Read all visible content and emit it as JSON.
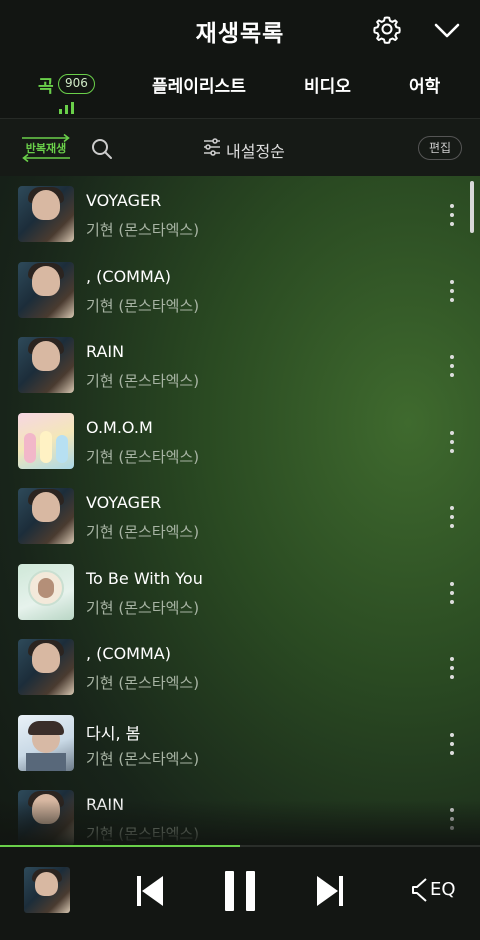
{
  "header": {
    "title": "재생목록"
  },
  "tabs": [
    {
      "label": "곡",
      "count": "906",
      "active": true
    },
    {
      "label": "플레이리스트"
    },
    {
      "label": "비디오"
    },
    {
      "label": "어학"
    }
  ],
  "toolbar": {
    "repeat_label": "반복재생",
    "sort_label": "내설정순",
    "edit_label": "편집"
  },
  "tracks": [
    {
      "title": "VOYAGER",
      "artist": "기현 (몬스타엑스)",
      "art": "voyager"
    },
    {
      "title": ", (COMMA)",
      "artist": "기현 (몬스타엑스)",
      "art": "voyager"
    },
    {
      "title": "RAIN",
      "artist": "기현 (몬스타엑스)",
      "art": "voyager"
    },
    {
      "title": "O.M.O.M",
      "artist": "기현 (몬스타엑스)",
      "art": "omom"
    },
    {
      "title": "VOYAGER",
      "artist": "기현 (몬스타엑스)",
      "art": "voyager"
    },
    {
      "title": "To Be With You",
      "artist": "기현 (몬스타엑스)",
      "art": "tobe"
    },
    {
      "title": ", (COMMA)",
      "artist": "기현 (몬스타엑스)",
      "art": "voyager"
    },
    {
      "title": "다시, 봄",
      "artist": "기현 (몬스타엑스)",
      "art": "dasi"
    },
    {
      "title": "RAIN",
      "artist": "기현 (몬스타엑스)",
      "art": "voyager"
    }
  ],
  "player": {
    "progress": 0.5,
    "eq_label": "EQ"
  },
  "colors": {
    "accent": "#6ad04a",
    "background": "#121512"
  },
  "icons": [
    "gear-icon",
    "chevron-down-icon",
    "search-icon",
    "sort-sliders-icon",
    "more-vertical-icon",
    "previous-icon",
    "pause-icon",
    "next-icon",
    "eq-icon"
  ]
}
